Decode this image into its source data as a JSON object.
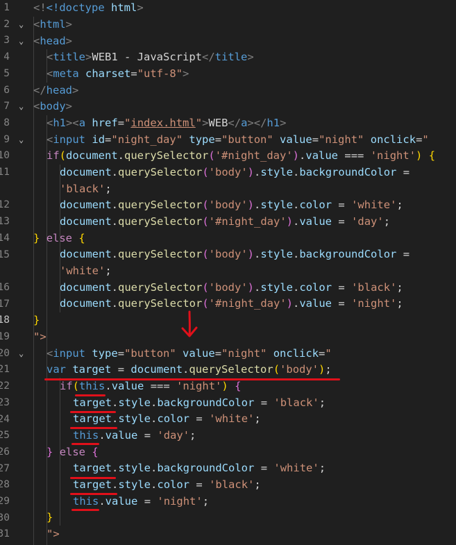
{
  "gutter": [
    "1",
    "2",
    "3",
    "4",
    "5",
    "6",
    "7",
    "8",
    "9",
    "10",
    "11",
    "",
    "12",
    "13",
    "14",
    "15",
    "",
    "16",
    "17",
    "18",
    "19",
    "20",
    "21",
    "22",
    "23",
    "24",
    "25",
    "26",
    "27",
    "28",
    "29",
    "30",
    "31"
  ],
  "code": {
    "l1_doctype": "<!doctype",
    "l1_html": "html",
    "l1_close": ">",
    "t_html": "html",
    "t_head": "head",
    "t_title": "title",
    "t_meta": "meta",
    "t_body": "body",
    "t_h1": "h1",
    "t_a": "a",
    "t_input": "input",
    "title_text": "WEB1 - JavaScript",
    "a_charset": "charset",
    "v_charset": "\"utf-8\"",
    "a_href": "href",
    "v_href": "index.html",
    "link_text": "WEB",
    "a_id": "id",
    "v_id": "\"night_day\"",
    "a_type": "type",
    "v_type": "\"button\"",
    "a_value": "value",
    "v_value": "\"night\"",
    "a_onclick": "onclick",
    "q_open": "\"",
    "kw_if": "if",
    "kw_else": "else",
    "kw_var": "var",
    "kw_this": "this",
    "document": "document",
    "querySelector": "querySelector",
    "style": "style",
    "backgroundColor": "backgroundColor",
    "color": "color",
    "value": "value",
    "target": "target",
    "s_night_sel": "'#night_day'",
    "s_body": "'body'",
    "s_night": "'night'",
    "s_black": "'black'",
    "s_white": "'white'",
    "s_day": "'day'",
    "op_eq3": "===",
    "op_eq": "=",
    "end_attr": "\">"
  }
}
